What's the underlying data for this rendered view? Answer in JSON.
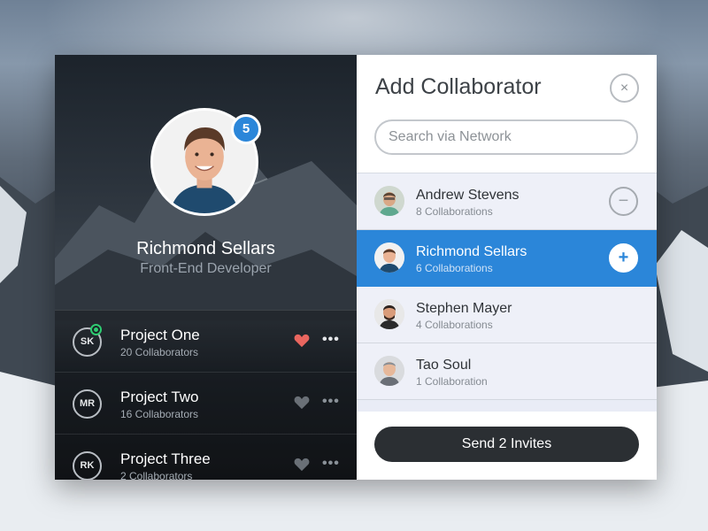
{
  "profile": {
    "name": "Richmond Sellars",
    "role": "Front-End Developer",
    "badge_count": "5"
  },
  "projects": [
    {
      "initials": "SK",
      "title": "Project One",
      "subtitle": "20 Collaborators",
      "favorited": true,
      "online": true
    },
    {
      "initials": "MR",
      "title": "Project Two",
      "subtitle": "16 Collaborators",
      "favorited": false,
      "online": false
    },
    {
      "initials": "RK",
      "title": "Project Three",
      "subtitle": "2 Collaborators",
      "favorited": false,
      "online": false
    }
  ],
  "panel": {
    "title": "Add Collaborator",
    "close_icon": "×",
    "search_placeholder": "Search via Network"
  },
  "collaborators": [
    {
      "name": "Andrew Stevens",
      "subtitle": "8 Collaborations",
      "action_icon": "−",
      "selected": false
    },
    {
      "name": "Richmond Sellars",
      "subtitle": "6 Collaborations",
      "action_icon": "+",
      "selected": true
    },
    {
      "name": "Stephen Mayer",
      "subtitle": "4 Collaborations"
    },
    {
      "name": "Tao Soul",
      "subtitle": "1 Collaboration"
    }
  ],
  "footer": {
    "send_label": "Send 2 Invites"
  },
  "colors": {
    "accent": "#2b86d9",
    "heart_active": "#e9665f",
    "heart_inactive": "#6a7077",
    "online": "#2ecc71",
    "send_button": "#2b2f33"
  },
  "icons": {
    "heart": "heart-icon",
    "more": "more-icon",
    "close": "close-icon",
    "add": "plus-icon",
    "remove": "minus-icon"
  },
  "more_glyph": "•••"
}
